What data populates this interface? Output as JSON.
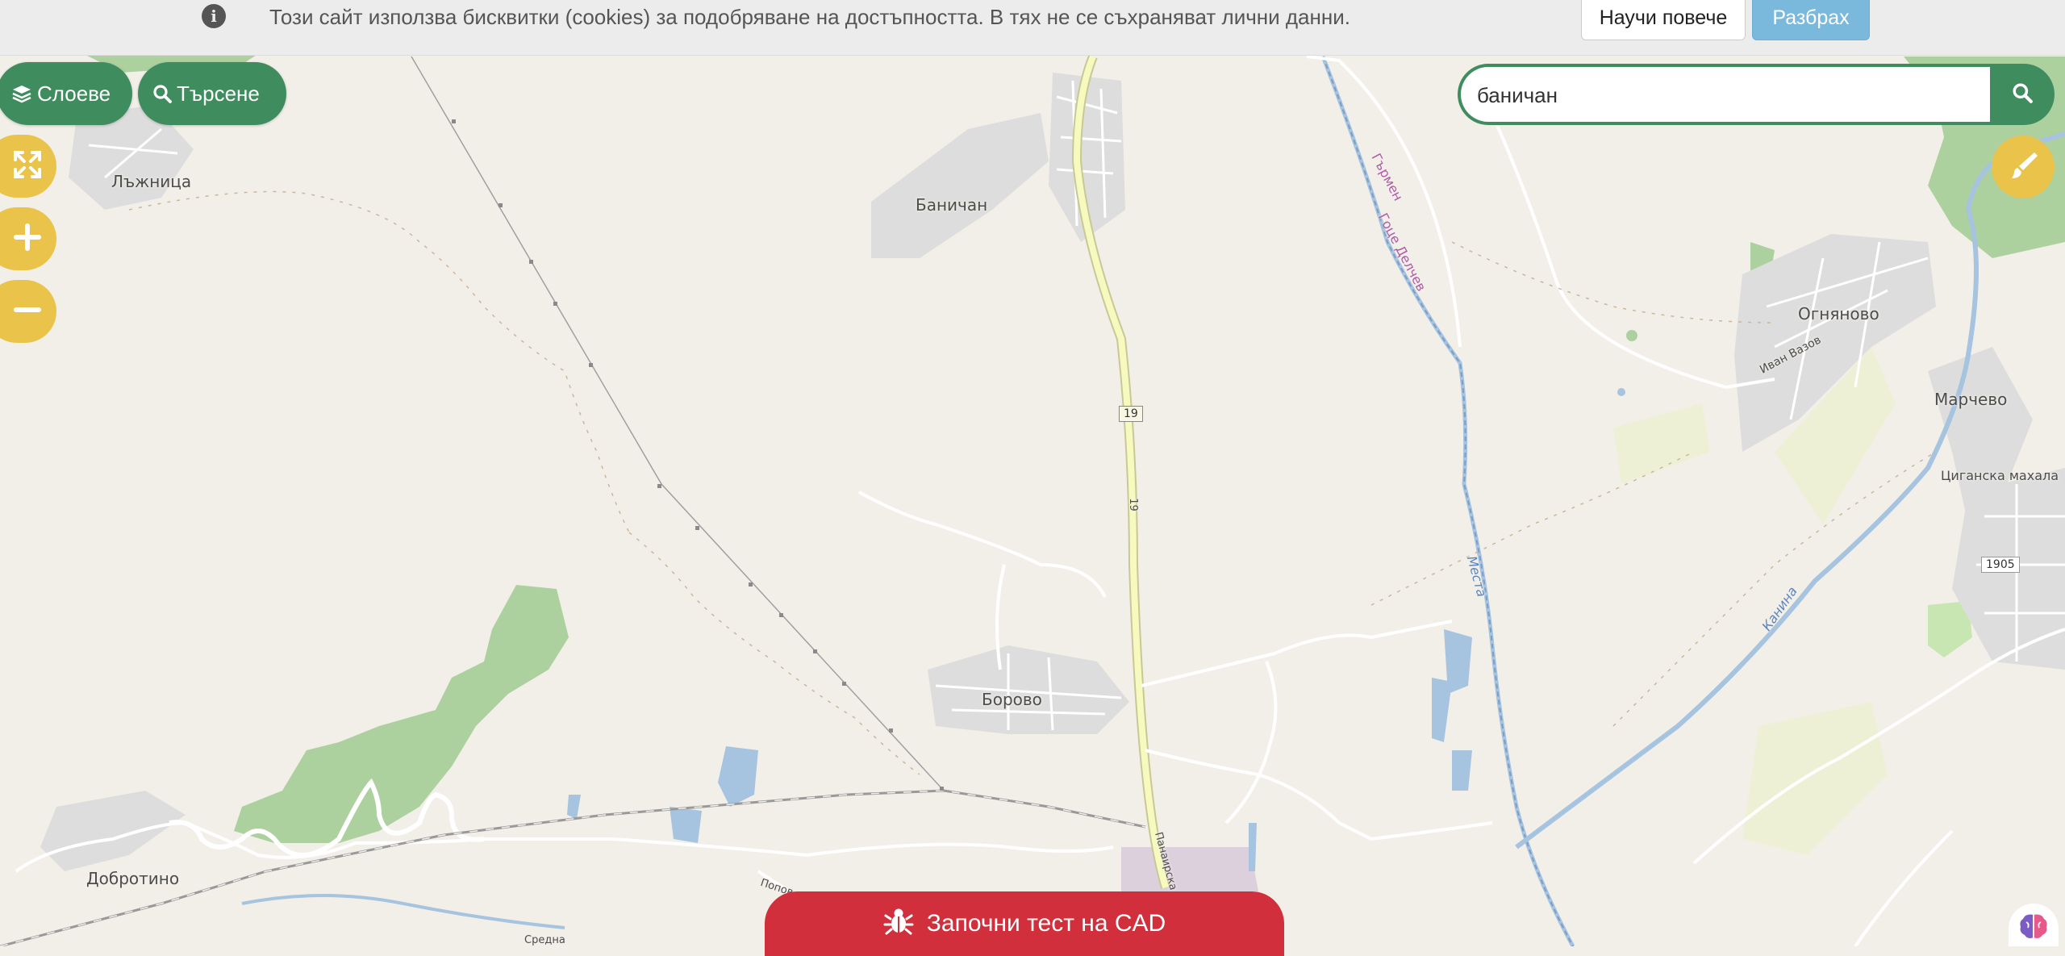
{
  "cookie_bar": {
    "info_icon": "info-circle-icon",
    "text": "Този сайт използва бисквитки (cookies) за подобряване на достъпността. В тях не се съхраняват лични данни.",
    "learn_more_label": "Научи повече",
    "accept_label": "Разбрах"
  },
  "toolbar": {
    "layers_label": "Слоеве",
    "layers_icon": "layers-icon",
    "search_label": "Търсене",
    "search_icon": "search-icon"
  },
  "map_controls": {
    "fullscreen_icon": "expand-icon",
    "zoom_in_icon": "plus-icon",
    "zoom_out_icon": "minus-icon",
    "draw_icon": "paintbrush-icon"
  },
  "search": {
    "value": "баничан",
    "button_icon": "search-icon"
  },
  "cad_button": {
    "label": "Започни тест на CAD",
    "icon": "bug-icon"
  },
  "brand_icon": "brain-icon",
  "map_labels": {
    "lazhnitsa": "Лъжница",
    "banichan": "Баничан",
    "borovo": "Борово",
    "dobrotino": "Добротино",
    "ognyanovo": "Огняново",
    "marchevo": "Марчево",
    "tsiganska_mahala": "Циганска махала",
    "ivan_vazov": "Иван Вазов",
    "garmen": "Гърмен",
    "gotse_delchev": "Гоце Делчев",
    "mesta": "Места",
    "kanina": "Канина",
    "road_19_a": "19",
    "road_19_b": "19",
    "road_1905": "1905",
    "panairska": "Панаирска",
    "popov": "Попов",
    "sredna": "Средна"
  },
  "colors": {
    "green": "#3f8d5e",
    "yellow": "#e9c34a",
    "red": "#d12f3b",
    "accept_blue": "#7ab8dc",
    "map_bg": "#f2efe9"
  }
}
